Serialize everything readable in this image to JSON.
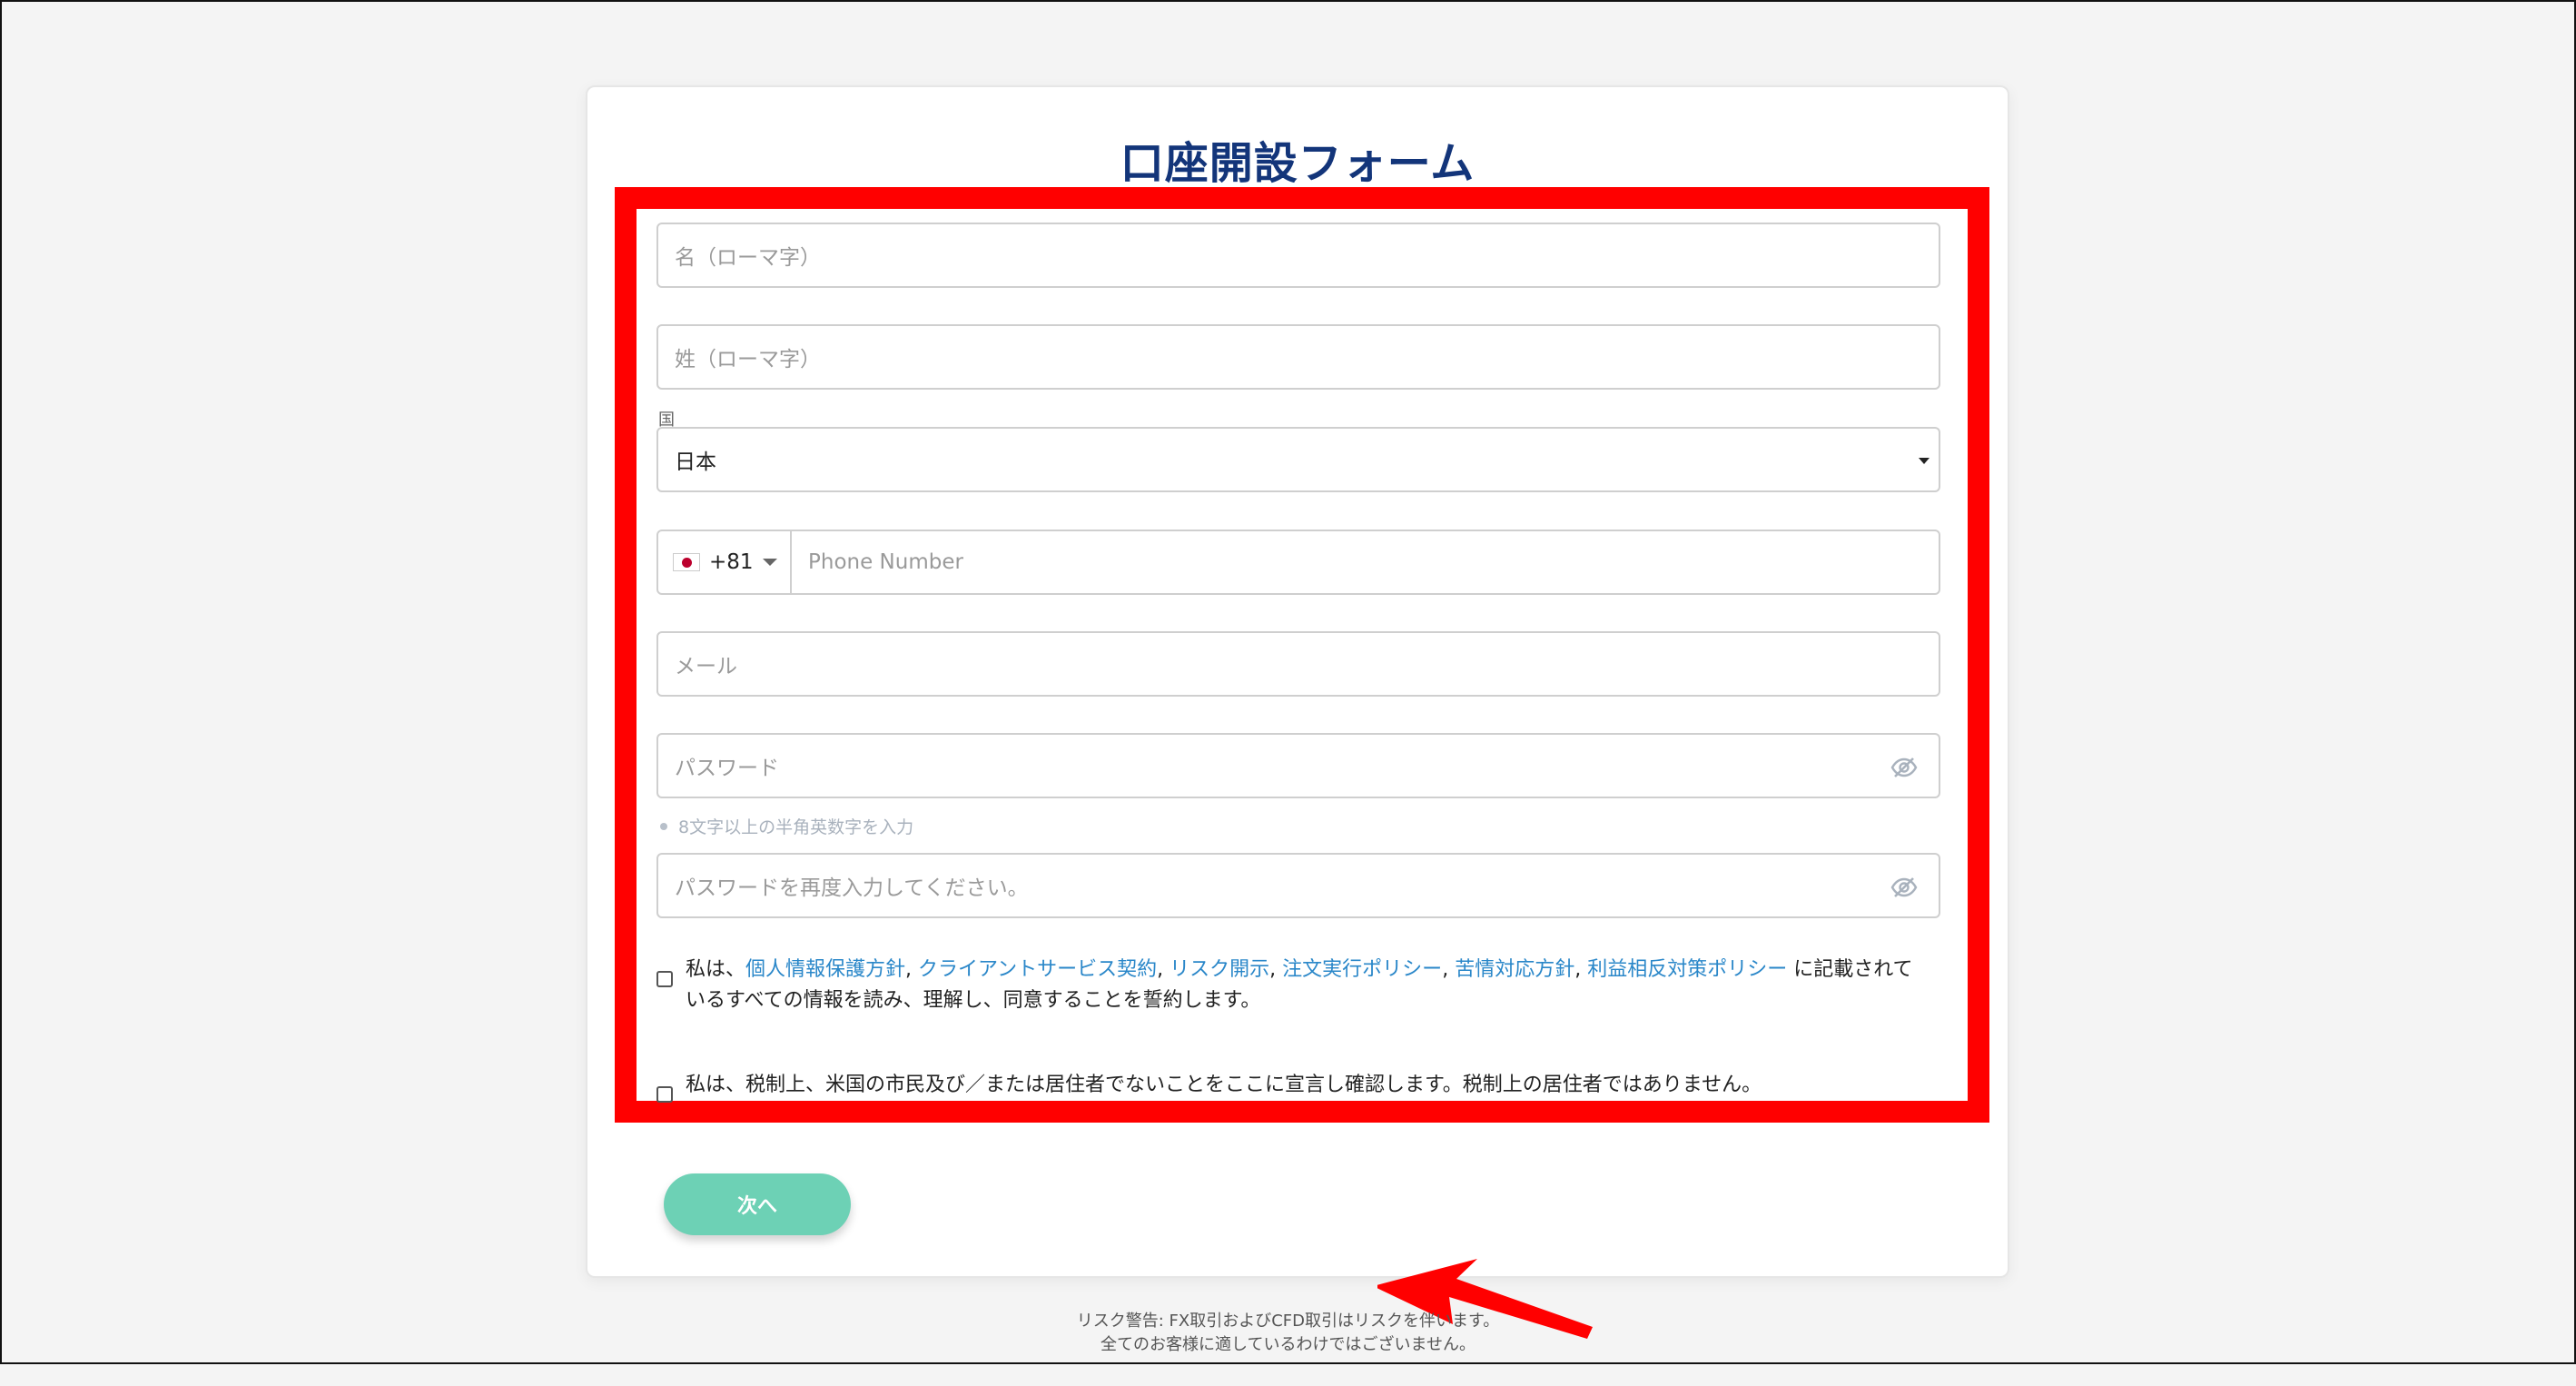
{
  "form": {
    "title": "口座開設フォーム",
    "first_name_placeholder": "名（ローマ字）",
    "last_name_placeholder": "姓（ローマ字）",
    "country_label": "国",
    "country_value": "日本",
    "phone_code": "+81",
    "phone_placeholder": "Phone Number",
    "email_placeholder": "メール",
    "password_placeholder": "パスワード",
    "password_hint": "8文字以上の半角英数字を入力",
    "password_confirm_placeholder": "パスワードを再度入力してください。"
  },
  "consent": {
    "prefix": "私は、",
    "links": [
      "個人情報保護方針",
      "クライアントサービス契約",
      "リスク開示",
      "注文実行ポリシー",
      "苦情対応方針",
      "利益相反対策ポリシー"
    ],
    "suffix_line1": " に記載されて",
    "suffix_line2": "いるすべての情報を読み、理解し、同意することを誓約します。",
    "tax_text": "私は、税制上、米国の市民及び／または居住者でないことをここに宣言し確認します。税制上の居住者ではありません。"
  },
  "buttons": {
    "next": "次へ"
  },
  "footer": {
    "line1": "リスク警告: FX取引およびCFD取引はリスクを伴います。",
    "line2": "全てのお客様に適しているわけではございません。"
  },
  "colors": {
    "title": "#13357a",
    "highlight": "#ff0000",
    "link": "#2a87c9",
    "button": "#6dd1b5"
  }
}
